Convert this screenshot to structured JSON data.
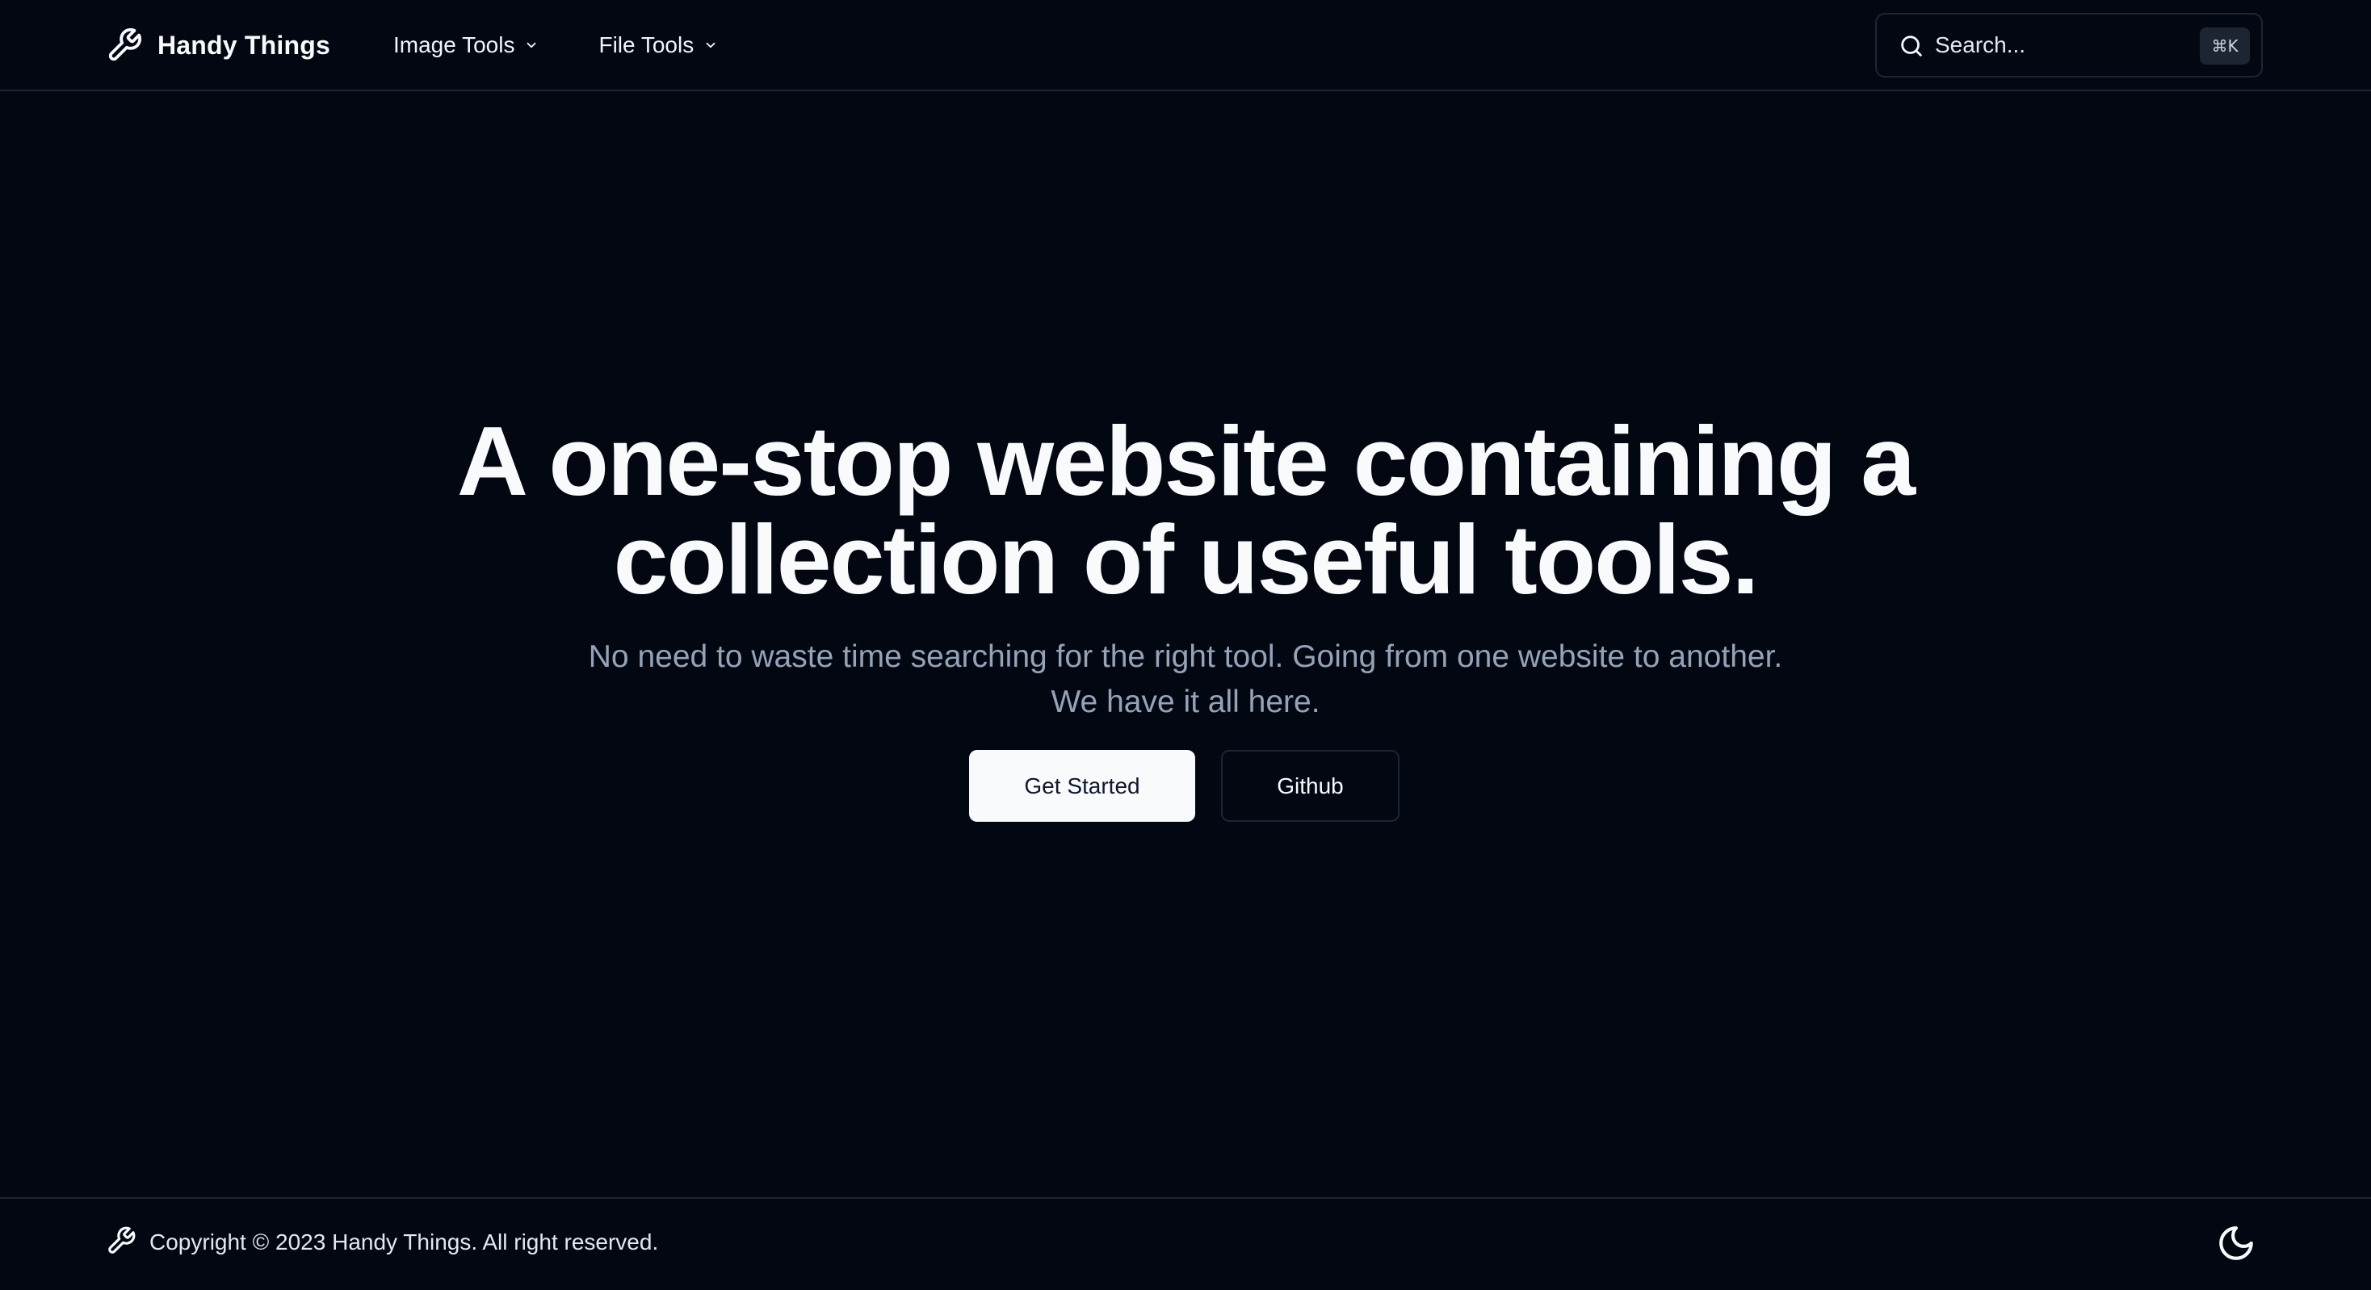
{
  "header": {
    "brand_name": "Handy Things",
    "brand_icon": "wrench-icon",
    "nav": [
      {
        "label": "Image Tools",
        "icon": "chevron-down-icon"
      },
      {
        "label": "File Tools",
        "icon": "chevron-down-icon"
      }
    ],
    "search": {
      "placeholder": "Search...",
      "icon": "search-icon",
      "shortcut": "⌘K"
    }
  },
  "hero": {
    "title_line1": "A one-stop website containing a",
    "title_line2": "collection of useful tools.",
    "subtitle": "No need to waste time searching for the right tool. Going from one website to another. We have it all here.",
    "primary_button": "Get Started",
    "secondary_button": "Github"
  },
  "footer": {
    "copyright": "Copyright © 2023 Handy Things. All right reserved.",
    "icon": "wrench-icon",
    "theme_toggle_icon": "moon-icon"
  },
  "colors": {
    "background": "#030712",
    "border": "#1e2532",
    "text_primary": "#f8fafc",
    "text_muted": "#94a3b8",
    "button_primary_bg": "#f8fafc",
    "button_primary_text": "#0f172a"
  }
}
